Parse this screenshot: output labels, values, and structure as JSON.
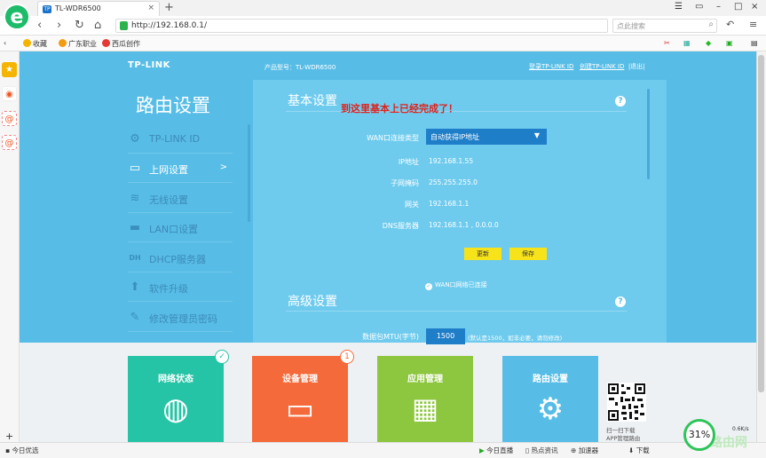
{
  "browser": {
    "tab_title": "TL-WDR6500",
    "tab_favicon_text": "TP",
    "url": "http://192.168.0.1/",
    "search_placeholder": "点此搜索",
    "bookmarks": [
      "收藏",
      "广东职业",
      "西瓜创作"
    ],
    "logo_letter": "e"
  },
  "header": {
    "brand": "TP-LINK",
    "model": "产品型号：TL-WDR6500",
    "login_link": "登录TP-LINK ID",
    "create_link": "创建TP-LINK ID",
    "exit_link": "|退出|"
  },
  "menu": {
    "title": "路由设置",
    "items": [
      {
        "label": "TP-LINK ID",
        "icon": "gear-icon"
      },
      {
        "label": "上网设置",
        "icon": "laptop-icon",
        "arrow": ">"
      },
      {
        "label": "无线设置",
        "icon": "wifi-icon"
      },
      {
        "label": "LAN口设置",
        "icon": "lan-icon"
      },
      {
        "label": "DHCP服务器",
        "icon": "dhcp-icon"
      },
      {
        "label": "软件升级",
        "icon": "upload-icon"
      },
      {
        "label": "修改管理员密码",
        "icon": "pencil-icon"
      }
    ]
  },
  "basic": {
    "title": "基本设置",
    "annotation": "到这里基本上已经完成了！",
    "wan_type_label": "WAN口连接类型",
    "wan_type_value": "自动获得IP地址",
    "fields": [
      {
        "label": "IP地址",
        "value": "192.168.1.55"
      },
      {
        "label": "子网掩码",
        "value": "255.255.255.0"
      },
      {
        "label": "网关",
        "value": "192.168.1.1"
      },
      {
        "label": "DNS服务器",
        "value": "192.168.1.1 , 0.0.0.0"
      }
    ],
    "update_btn": "更新",
    "save_btn": "保存",
    "status": "WAN口网络已连接"
  },
  "advanced": {
    "title": "高级设置",
    "mtu_label": "数据包MTU(字节)",
    "mtu_value": "1500",
    "mtu_note": "(默认是1500，如非必要，请勿修改)"
  },
  "tiles": [
    {
      "label": "网络状态",
      "color": "#26c4a6",
      "badge": "✓"
    },
    {
      "label": "设备管理",
      "color": "#f56a3a",
      "badge": "1"
    },
    {
      "label": "应用管理",
      "color": "#8dc63f"
    },
    {
      "label": "路由设置",
      "color": "#57bde6"
    }
  ],
  "qr": {
    "line1": "扫一扫下载",
    "line2": "APP管理路由"
  },
  "statusbar": {
    "left": "今日优选",
    "items": [
      "今日直播",
      "热点资讯",
      "加速器",
      "下载"
    ],
    "speed_percent": "31%",
    "speed_rate": "0.6K/s",
    "watermark": "路由网"
  }
}
